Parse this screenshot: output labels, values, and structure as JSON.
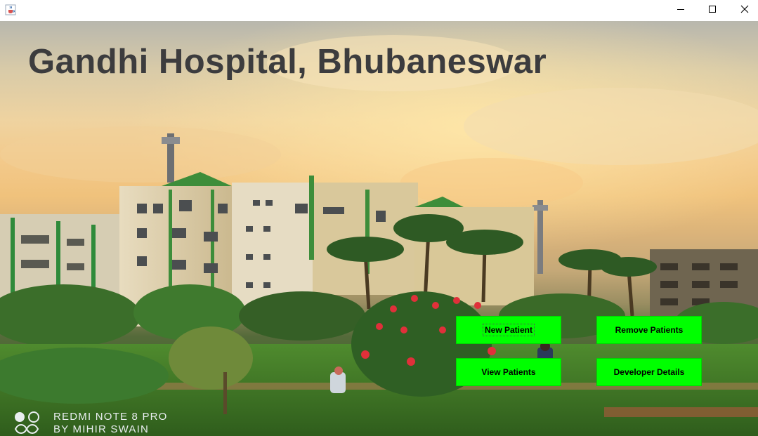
{
  "window": {
    "app_icon": "java-cup-icon",
    "controls": [
      "minimize-icon",
      "maximize-icon",
      "close-icon"
    ]
  },
  "header": {
    "title": "Gandhi Hospital, Bhubaneswar"
  },
  "actions": {
    "new_patient": "New Patient",
    "remove_patients": "Remove Patients",
    "view_patients": "View Patients",
    "developer_details": "Developer Details"
  },
  "photo_watermark": {
    "line1": "REDMI NOTE 8 PRO",
    "line2": "BY MIHIR SWAIN"
  },
  "colors": {
    "button_bg": "#00ff00",
    "title_text": "#3c3c3e"
  }
}
